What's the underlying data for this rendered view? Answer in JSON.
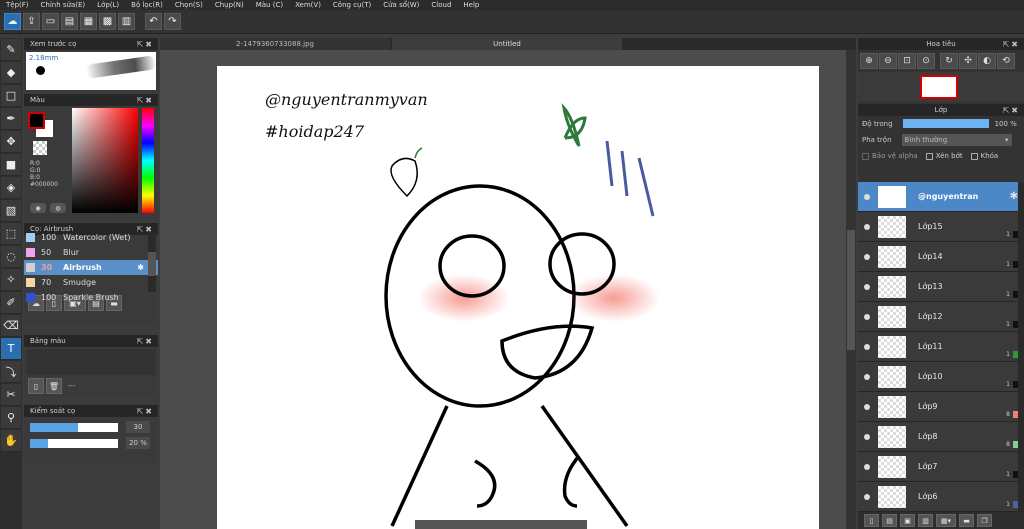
{
  "menu": [
    "Tệp(F)",
    "Chỉnh sửa(E)",
    "Lớp(L)",
    "Bộ lọc(R)",
    "Chọn(S)",
    "Chụp(N)",
    "Màu (C)",
    "Xem(V)",
    "Công cụ(T)",
    "Cửa sổ(W)",
    "Cloud",
    "Help"
  ],
  "brush_preview": {
    "title": "Xem trước cọ",
    "size": "2.18mm"
  },
  "color_panel": {
    "title": "Màu",
    "r": "R:0",
    "g": "G:0",
    "b": "B:0",
    "hex": "#000000",
    "fg": "#000000",
    "bg": "#ffffff"
  },
  "brush_panel": {
    "title": "Cọ: Airbrush",
    "items": [
      {
        "size": "100",
        "name": "Watercolor (Wet)",
        "color": "#9fd0f0"
      },
      {
        "size": "50",
        "name": "Blur",
        "color": "#f0a0f0"
      },
      {
        "size": "30",
        "name": "Airbrush",
        "color": "#d0d0d0"
      },
      {
        "size": "70",
        "name": "Smudge",
        "color": "#f5d5a0"
      },
      {
        "size": "100",
        "name": "Sparkle Brush",
        "color": "#3050d0"
      }
    ]
  },
  "palette_panel": {
    "title": "Bảng màu",
    "value": "---"
  },
  "brush_control": {
    "title": "Kiểm soát cọ",
    "size": "30",
    "size_fraction": 0.55,
    "opacity": "20 %",
    "opacity_fraction": 0.2
  },
  "tabs": [
    "2-1479360733088.jpg",
    "Untitled"
  ],
  "canvas": {
    "line1": "@nguyentranmyvan",
    "line2": "#hoidap247"
  },
  "navigator": {
    "title": "Hoa tiêu"
  },
  "layers_panel": {
    "title": "Lớp",
    "opacity_label": "Độ trong",
    "opacity_value": "100 %",
    "blend_label": "Pha trộn",
    "blend_value": "Bình thường",
    "protect_alpha": "Bảo vệ alpha",
    "clip": "Xén bớt",
    "lock": "Khóa",
    "layers": [
      {
        "name": "@nguyentran",
        "selected": true,
        "count": "",
        "chip": ""
      },
      {
        "name": "Lớp15",
        "count": "1",
        "chip": "#111111"
      },
      {
        "name": "Lớp14",
        "count": "1",
        "chip": "#111111"
      },
      {
        "name": "Lớp13",
        "count": "1",
        "chip": "#111111"
      },
      {
        "name": "Lớp12",
        "count": "1",
        "chip": "#111111"
      },
      {
        "name": "Lớp11",
        "count": "1",
        "chip": "#2e9a3a"
      },
      {
        "name": "Lớp10",
        "count": "1",
        "chip": "#111111"
      },
      {
        "name": "Lớp9",
        "count": "8",
        "chip": "#f08070"
      },
      {
        "name": "Lớp8",
        "count": "8",
        "chip": "#80d090"
      },
      {
        "name": "Lớp7",
        "count": "1",
        "chip": "#111111"
      },
      {
        "name": "Lớp6",
        "count": "1",
        "chip": "#5060a0"
      }
    ]
  }
}
